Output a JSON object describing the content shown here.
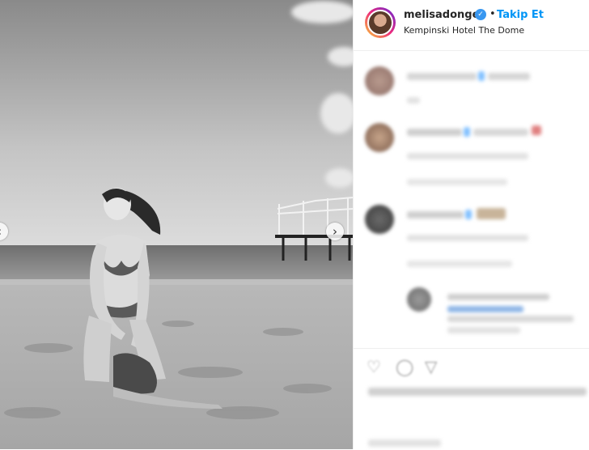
{
  "post": {
    "username": "melisadongel",
    "follow_label": "Takip Et",
    "separator": "•",
    "location": "Kempinski Hotel The Dome",
    "verified_icon": "checkmark-icon"
  },
  "carousel": {
    "next_icon": "›",
    "prev_icon": "‹"
  },
  "actions": {
    "heart": "♡",
    "comment": "◯",
    "share": "▽"
  },
  "colors": {
    "follow": "#0095f6",
    "verified": "#3897f0"
  }
}
